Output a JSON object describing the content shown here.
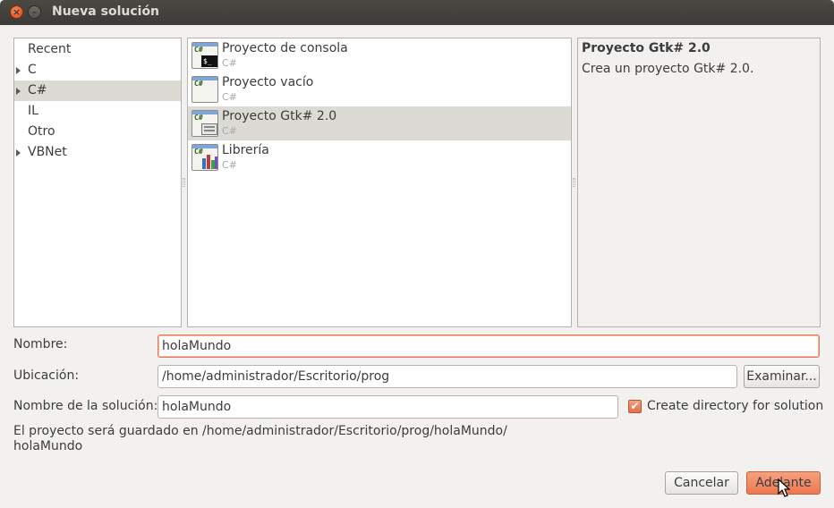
{
  "window": {
    "title": "Nueva solución"
  },
  "categories": [
    {
      "label": "Recent",
      "expandable": false,
      "selected": false
    },
    {
      "label": "C",
      "expandable": true,
      "selected": false
    },
    {
      "label": "C#",
      "expandable": true,
      "selected": true
    },
    {
      "label": "IL",
      "expandable": false,
      "selected": false
    },
    {
      "label": "Otro",
      "expandable": false,
      "selected": false
    },
    {
      "label": "VBNet",
      "expandable": true,
      "selected": false
    }
  ],
  "templates": [
    {
      "name": "Proyecto de consola",
      "lang": "C#",
      "icon": "console-project-icon",
      "selected": false
    },
    {
      "name": "Proyecto vacío",
      "lang": "C#",
      "icon": "empty-project-icon",
      "selected": false
    },
    {
      "name": "Proyecto Gtk# 2.0",
      "lang": "C#",
      "icon": "gtk-project-icon",
      "selected": true
    },
    {
      "name": "Librería",
      "lang": "C#",
      "icon": "library-project-icon",
      "selected": false
    }
  ],
  "icon_badge": "C#",
  "console_glyph": "$_",
  "description": {
    "title": "Proyecto Gtk# 2.0",
    "text": "Crea un proyecto Gtk# 2.0."
  },
  "form": {
    "name_label": "Nombre:",
    "name_value": "holaMundo",
    "location_label": "Ubicación:",
    "location_value": "/home/administrador/Escritorio/prog",
    "browse_label": "Examinar...",
    "solution_label": "Nombre de la solución:",
    "solution_value": "holaMundo",
    "create_dir_label": "Create directory for solution",
    "create_dir_checked": true,
    "checkmark": "✔",
    "save_path_line1": "El proyecto será guardado en /home/administrador/Escritorio/prog/holaMundo/",
    "save_path_line2": "holaMundo"
  },
  "buttons": {
    "cancel": "Cancelar",
    "next": "Adelante"
  },
  "window_buttons": {
    "close": "×",
    "minimize": "–"
  },
  "colors": {
    "accent": "#ec7951",
    "selection": "#dcdad5",
    "titlebar": "#3c3b37"
  }
}
